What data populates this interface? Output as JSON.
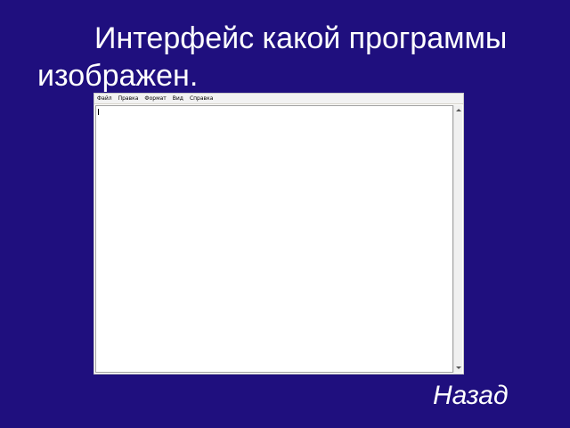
{
  "slide": {
    "title": "Интерфейс какой программы изображен.",
    "back_link_label": "Назад",
    "background_color": "#1f0f7e"
  },
  "notepad": {
    "menu": [
      {
        "label": "Файл"
      },
      {
        "label": "Правка"
      },
      {
        "label": "Формат"
      },
      {
        "label": "Вид"
      },
      {
        "label": "Справка"
      }
    ],
    "scroll_up_icon": "arrow-up-icon",
    "scroll_down_icon": "arrow-down-icon"
  }
}
